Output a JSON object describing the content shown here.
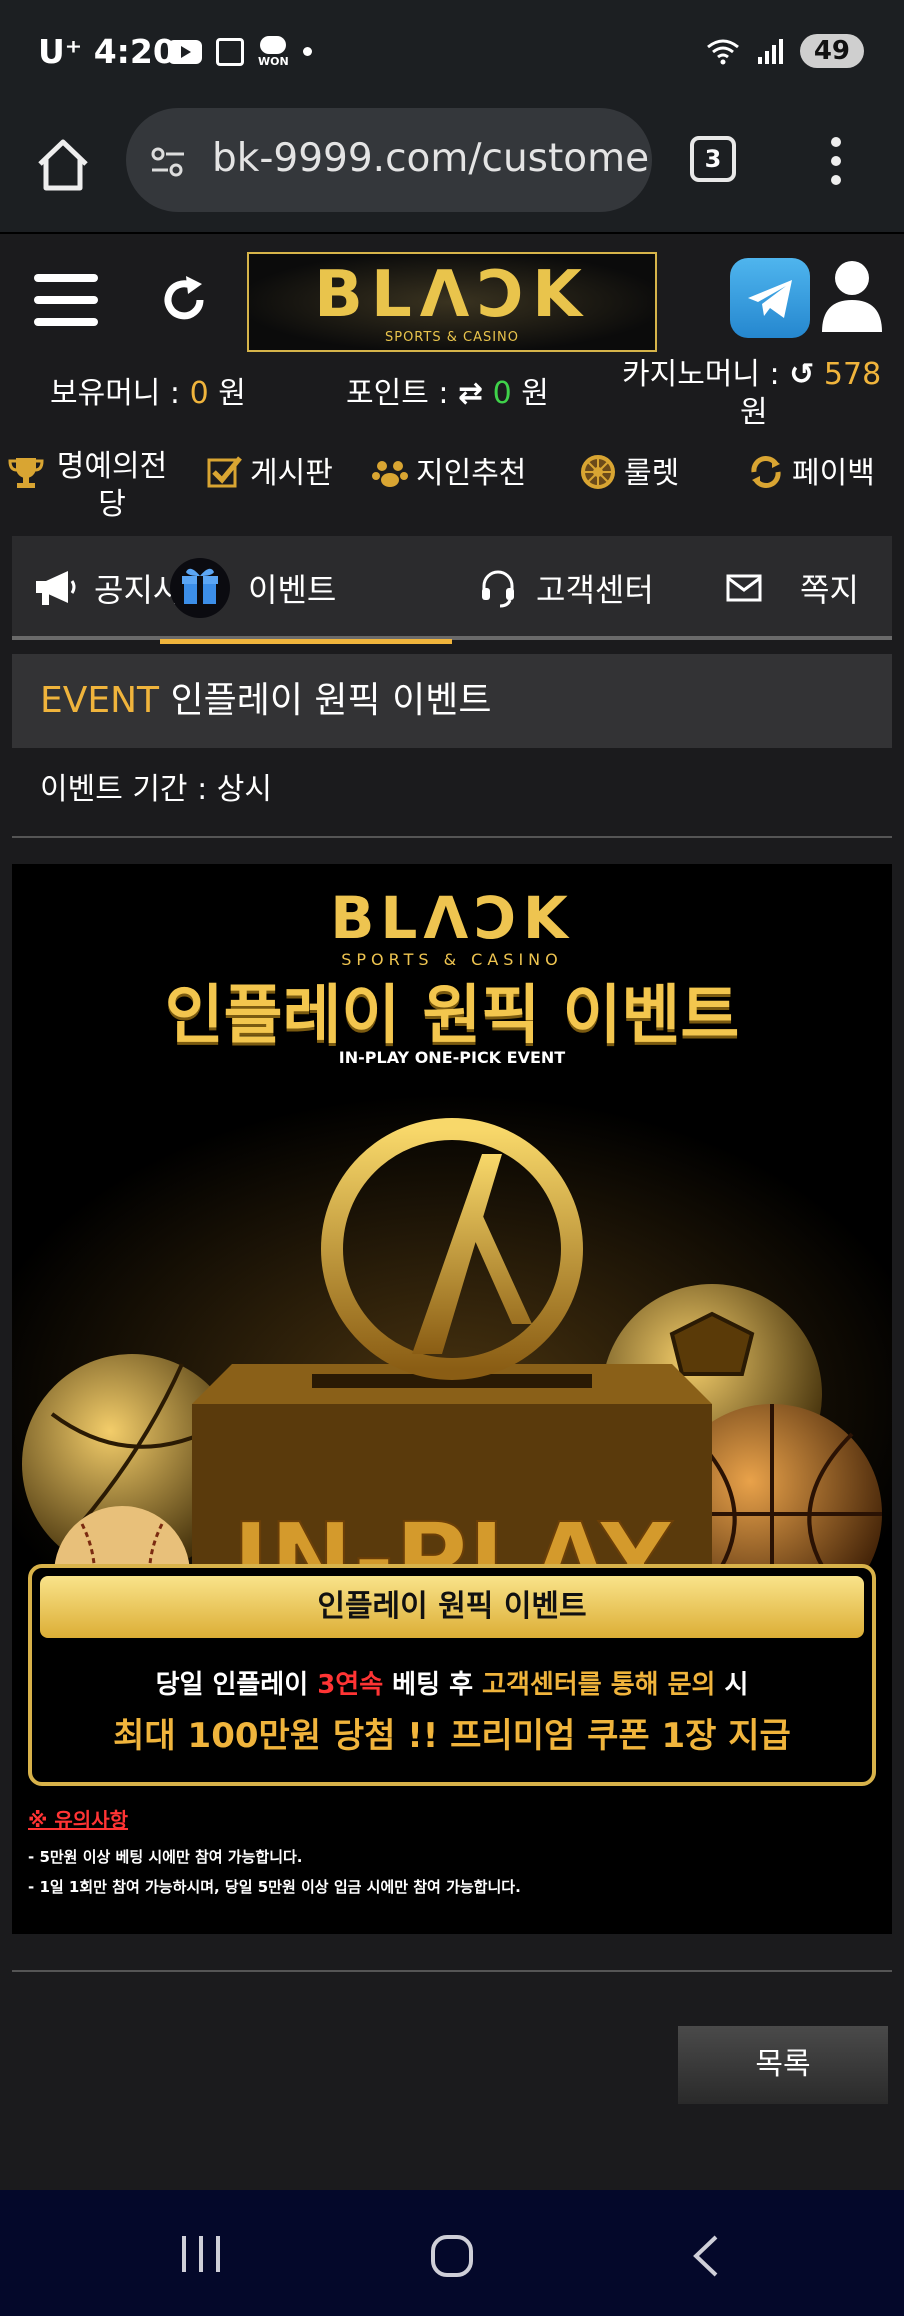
{
  "status_bar": {
    "carrier": "U⁺",
    "time": "4:20",
    "won_label": "WON",
    "battery": "49"
  },
  "browser": {
    "url": "bk-9999.com/customer",
    "tab_count": "3"
  },
  "header": {
    "logo_main": "BLΛƆK",
    "logo_sub": "SPORTS & CASINO",
    "holdings_label": "보유머니 : ",
    "holdings_value": "0",
    "holdings_unit": " 원",
    "points_label": "포인트 : ",
    "points_value": "0",
    "points_unit": " 원",
    "casino_label": "카지노머니 :",
    "casino_value": "578",
    "casino_unit": "원"
  },
  "quick_menu": [
    {
      "label": "명예의전당",
      "icon": "trophy-icon"
    },
    {
      "label": "게시판",
      "icon": "checkbox-icon"
    },
    {
      "label": "지인추천",
      "icon": "paw-icon"
    },
    {
      "label": "룰렛",
      "icon": "roulette-icon"
    },
    {
      "label": "페이백",
      "icon": "payback-icon"
    }
  ],
  "tabs": [
    {
      "label": "공지사항",
      "icon": "megaphone-icon"
    },
    {
      "label": "이벤트",
      "icon": "gift-icon",
      "active": true
    },
    {
      "label": "고객센터",
      "icon": "headset-icon"
    },
    {
      "label": "쪽지",
      "icon": "envelope-icon"
    }
  ],
  "post": {
    "category": "EVENT",
    "title": "인플레이 원픽 이벤트",
    "period": "이벤트 기간 : 상시"
  },
  "banner": {
    "logo_main": "BLΛƆK",
    "logo_sub": "SPORTS & CASINO",
    "title": "인플레이 원픽 이벤트",
    "subtitle": "IN-PLAY ONE-PICK EVENT",
    "box_text": "IN-PLAY",
    "promo_head": "인플레이 원픽 이벤트",
    "line1_a": "당일 인플레이 ",
    "line1_b": "3연속",
    "line1_c": " 베팅 후 ",
    "line1_d": "고객센터를 통해 문의",
    "line1_e": " 시",
    "line2": "최대 100만원 당첨 !! 프리미엄 쿠폰 1장 지급",
    "notice_head": "※ 유의사항",
    "notices": [
      "- 5만원 이상 베팅 시에만 참여 가능합니다.",
      "- 1일 1회만 참여 가능하시며, 당일 5만원 이상 입금 시에만 참여 가능합니다."
    ]
  },
  "list_button": "목록",
  "colors": {
    "accent": "#f0b43c",
    "points_green": "#3fd24a",
    "notice_red": "#ff3434"
  }
}
